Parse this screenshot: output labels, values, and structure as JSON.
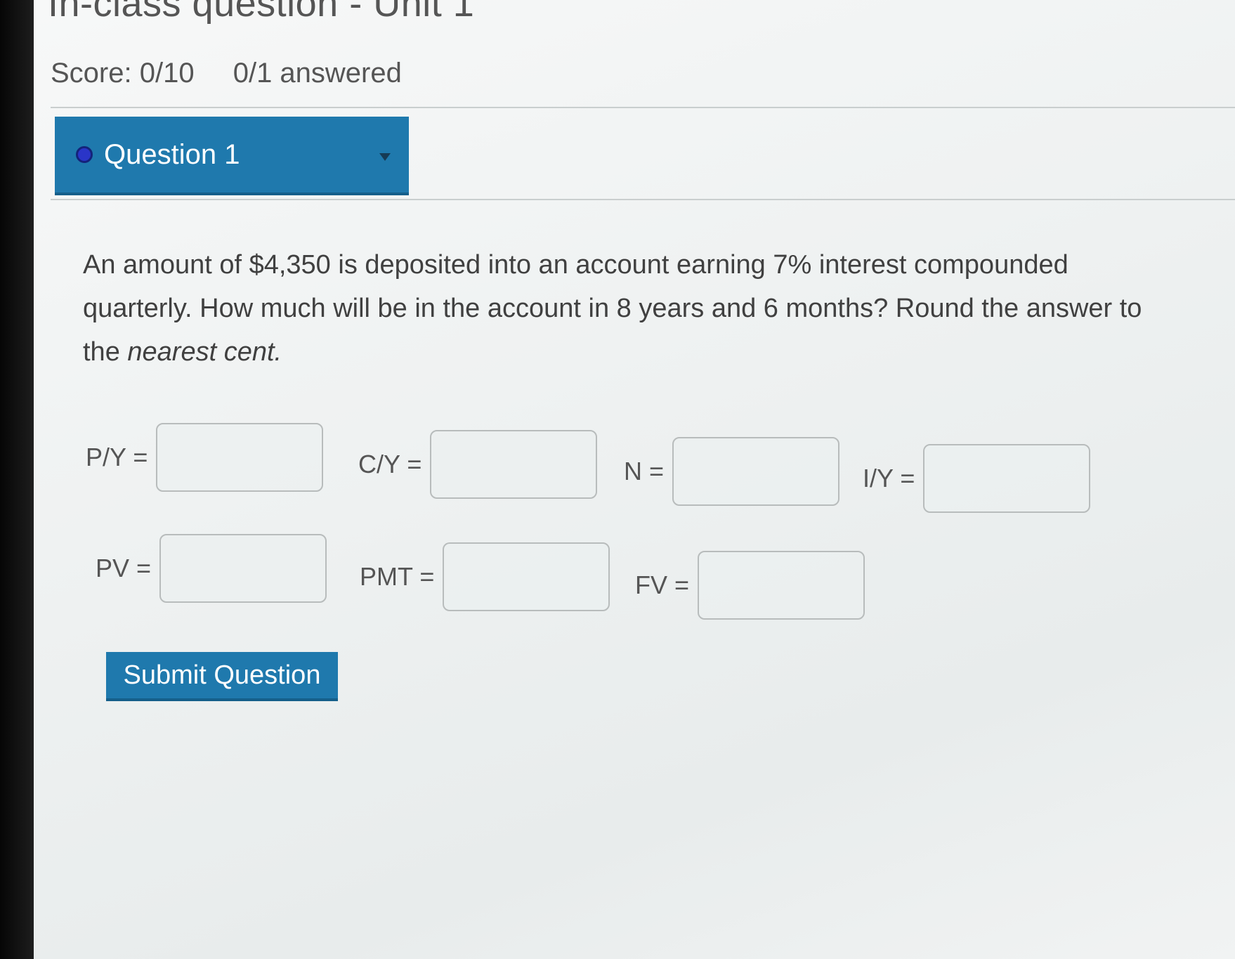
{
  "header": {
    "title": "In-class question - Unit 1",
    "score": "Score: 0/10",
    "answered": "0/1 answered"
  },
  "question_selector": {
    "label": "Question 1"
  },
  "question": {
    "text_main": "An amount of $4,350 is deposited into an account earning 7% interest compounded quarterly. How much will be in the account in 8 years and 6 months? Round the answer to the ",
    "text_emphasis": "nearest cent."
  },
  "fields": {
    "py": {
      "label": "P/Y =",
      "value": ""
    },
    "cy": {
      "label": "C/Y =",
      "value": ""
    },
    "n": {
      "label": "N =",
      "value": ""
    },
    "iy": {
      "label": "I/Y =",
      "value": ""
    },
    "pv": {
      "label": "PV =",
      "value": ""
    },
    "pmt": {
      "label": "PMT =",
      "value": ""
    },
    "fv": {
      "label": "FV =",
      "value": ""
    }
  },
  "submit": {
    "label": "Submit Question"
  },
  "colors": {
    "accent": "#1f79ad",
    "dot": "#2a35c8"
  }
}
